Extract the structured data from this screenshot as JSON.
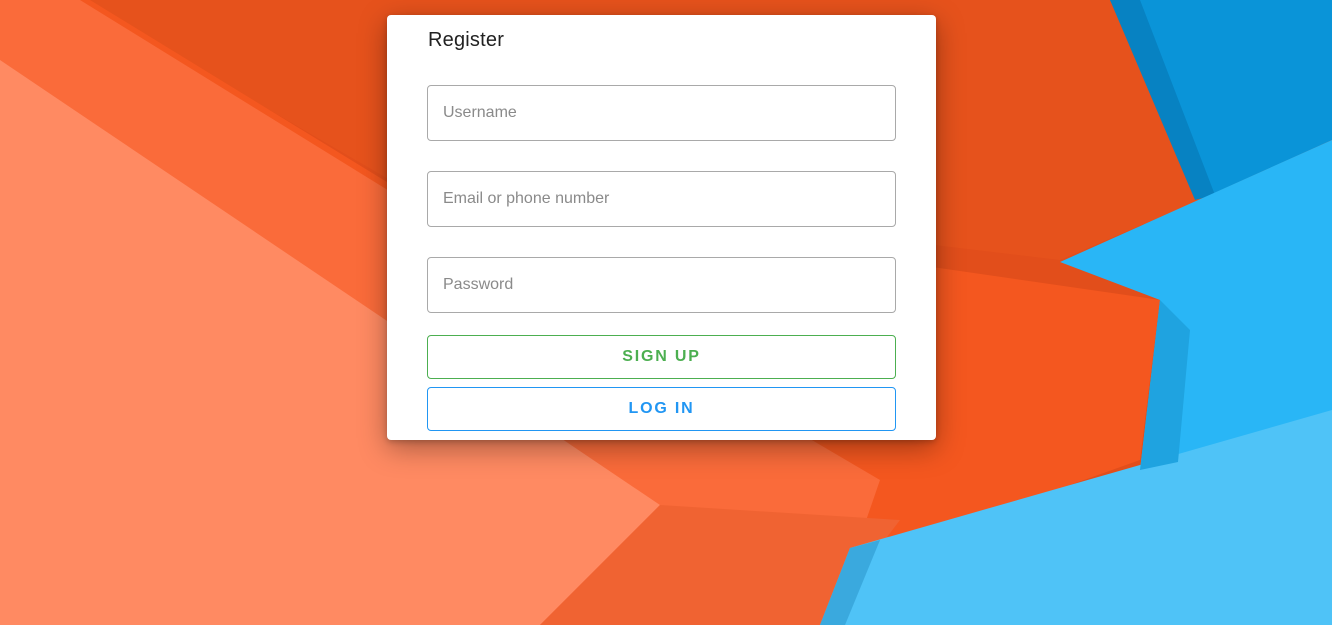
{
  "form": {
    "title": "Register",
    "username_placeholder": "Username",
    "email_placeholder": "Email or phone number",
    "password_placeholder": "Password",
    "signup_label": "SIGN UP",
    "login_label": "LOG IN"
  },
  "colors": {
    "signup_accent": "#4caf50",
    "login_accent": "#2196f3",
    "background_orange": "#e8521f",
    "background_blue": "#29b6f6"
  }
}
